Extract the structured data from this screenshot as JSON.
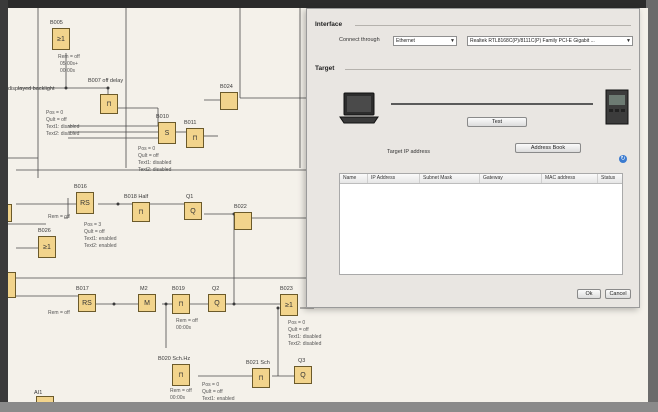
{
  "diagram": {
    "blocks": {
      "b005": "B005",
      "b007": "B007",
      "b007_desc": "off delay",
      "b010": "B010",
      "b011": "B011",
      "b024": "B024",
      "b016": "B016",
      "b016_desc": "",
      "b018": "B018",
      "b018_desc": "Half",
      "q1": "Q1",
      "b022": "B022",
      "b026": "B026",
      "b017": "B017",
      "m2": "M2",
      "b019": "B019",
      "q2": "Q2",
      "b023": "B023",
      "b020": "B020",
      "b020_desc": "Sch.Hz",
      "b021": "B021",
      "b021_desc": "Sch",
      "q3": "Q3",
      "ai1": "AI1"
    },
    "symbols": {
      "rs": "RS",
      "s": "S",
      "ge1": "≥1",
      "q": "Q",
      "m": "M",
      "amp": "&"
    },
    "texts": {
      "backlight": "displayed backlight",
      "rem_off": "Rem = off",
      "time_val": "05:00s+",
      "time_val2": "00:00s",
      "pos_0": "Pos = 0",
      "quit_off": "QuIt = off",
      "text1_dis": "Text1: disabled",
      "text2_dis": "Text2: disabled",
      "pos_3": "Pos = 3",
      "text1_en": "Text1: enabled",
      "text2_en": "Text2: enabled"
    }
  },
  "dialog": {
    "interface_title": "Interface",
    "connect_label": "Connect through",
    "connect_value": "Ethernet",
    "adapter_value": "Realtek RTL8168C(P)/8111C(P) Family PCI-E Gigabit ...",
    "target_title": "Target",
    "test_button": "Test",
    "target_ip_label": "Target IP address",
    "address_book_button": "Address Book",
    "columns": [
      "Name",
      "IP Address",
      "Subnet Mask",
      "Gateway",
      "MAC address",
      "Status"
    ],
    "ok_button": "Ok",
    "cancel_button": "Cancel"
  },
  "colors": {
    "block_fill": "#f2d48c",
    "canvas": "#f4f1ea",
    "dialog": "#e9e6e2"
  }
}
